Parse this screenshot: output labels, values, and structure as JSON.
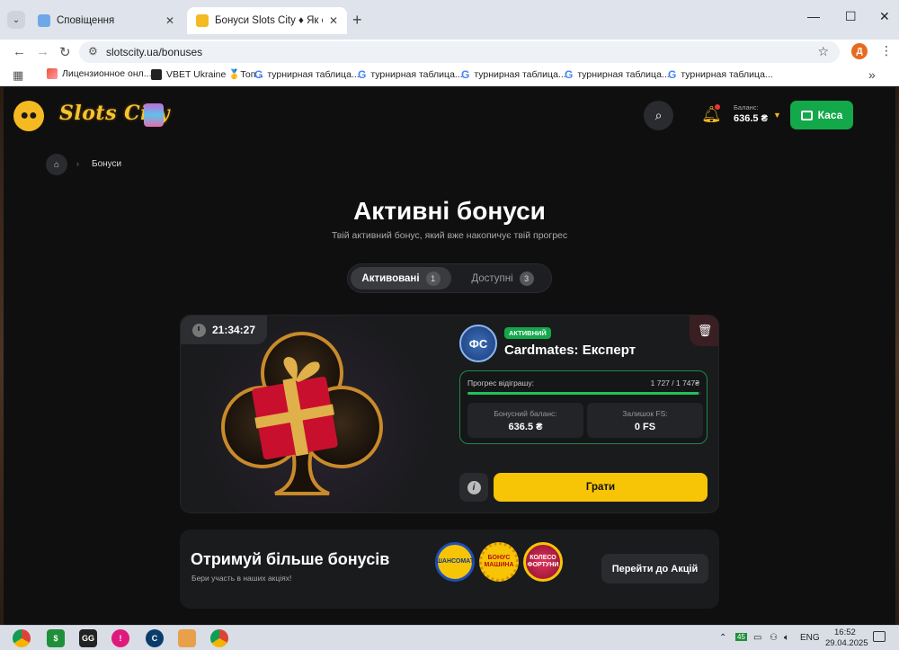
{
  "browser": {
    "tabs": [
      {
        "title": "Сповіщення",
        "active": false
      },
      {
        "title": "Бонуси Slots City ♦ Як отримати",
        "active": true
      }
    ],
    "url": "slotscity.ua/bonuses",
    "profile_initial": "Д",
    "bookmarks": [
      "Лицензионное онл...",
      "VBET Ukraine 🥇Топ...",
      "турнирная таблица...",
      "турнирная таблица...",
      "турнирная таблица...",
      "турнирная таблица...",
      "турнирная таблица..."
    ]
  },
  "header": {
    "logo_text": "Slots City",
    "balance_label": "Баланс:",
    "balance_value": "636.5 ₴",
    "cashier_label": "Каса"
  },
  "breadcrumb": {
    "current": "Бонуси"
  },
  "page": {
    "title": "Активні бонуси",
    "subtitle": "Твій активний бонус, який вже накопичує твій прогрес"
  },
  "segment": {
    "activated_label": "Активовані",
    "activated_count": "1",
    "available_label": "Доступні",
    "available_count": "3"
  },
  "bonus_card": {
    "timer": "21:34:27",
    "provider_badge": "ФС",
    "status": "АКТИВНИЙ",
    "name": "Cardmates: Експерт",
    "progress_label": "Прогрес відіграшу:",
    "progress_value": "1 727 / 1 747₴",
    "progress_fraction": 0.9886,
    "bonus_balance_label": "Бонусний баланс:",
    "bonus_balance_value": "636.5 ₴",
    "fs_left_label": "Залишок FS:",
    "fs_left_value": "0 FS",
    "play_label": "Грати"
  },
  "promo": {
    "title": "Отримуй більше бонусів",
    "subtitle": "Бери участь в наших акціях!",
    "badges": [
      "ШАНСОМАТ",
      "БОНУС МАШИНА",
      "КОЛЕСО ФОРТУНИ"
    ],
    "button_label": "Перейти до Акцій"
  },
  "taskbar": {
    "lang": "ENG",
    "time": "16:52",
    "date": "29.04.2025"
  },
  "colors": {
    "accent_yellow": "#f7c406",
    "accent_green": "#13a84a",
    "background": "#0f0f10",
    "card": "#1a1b1d"
  }
}
